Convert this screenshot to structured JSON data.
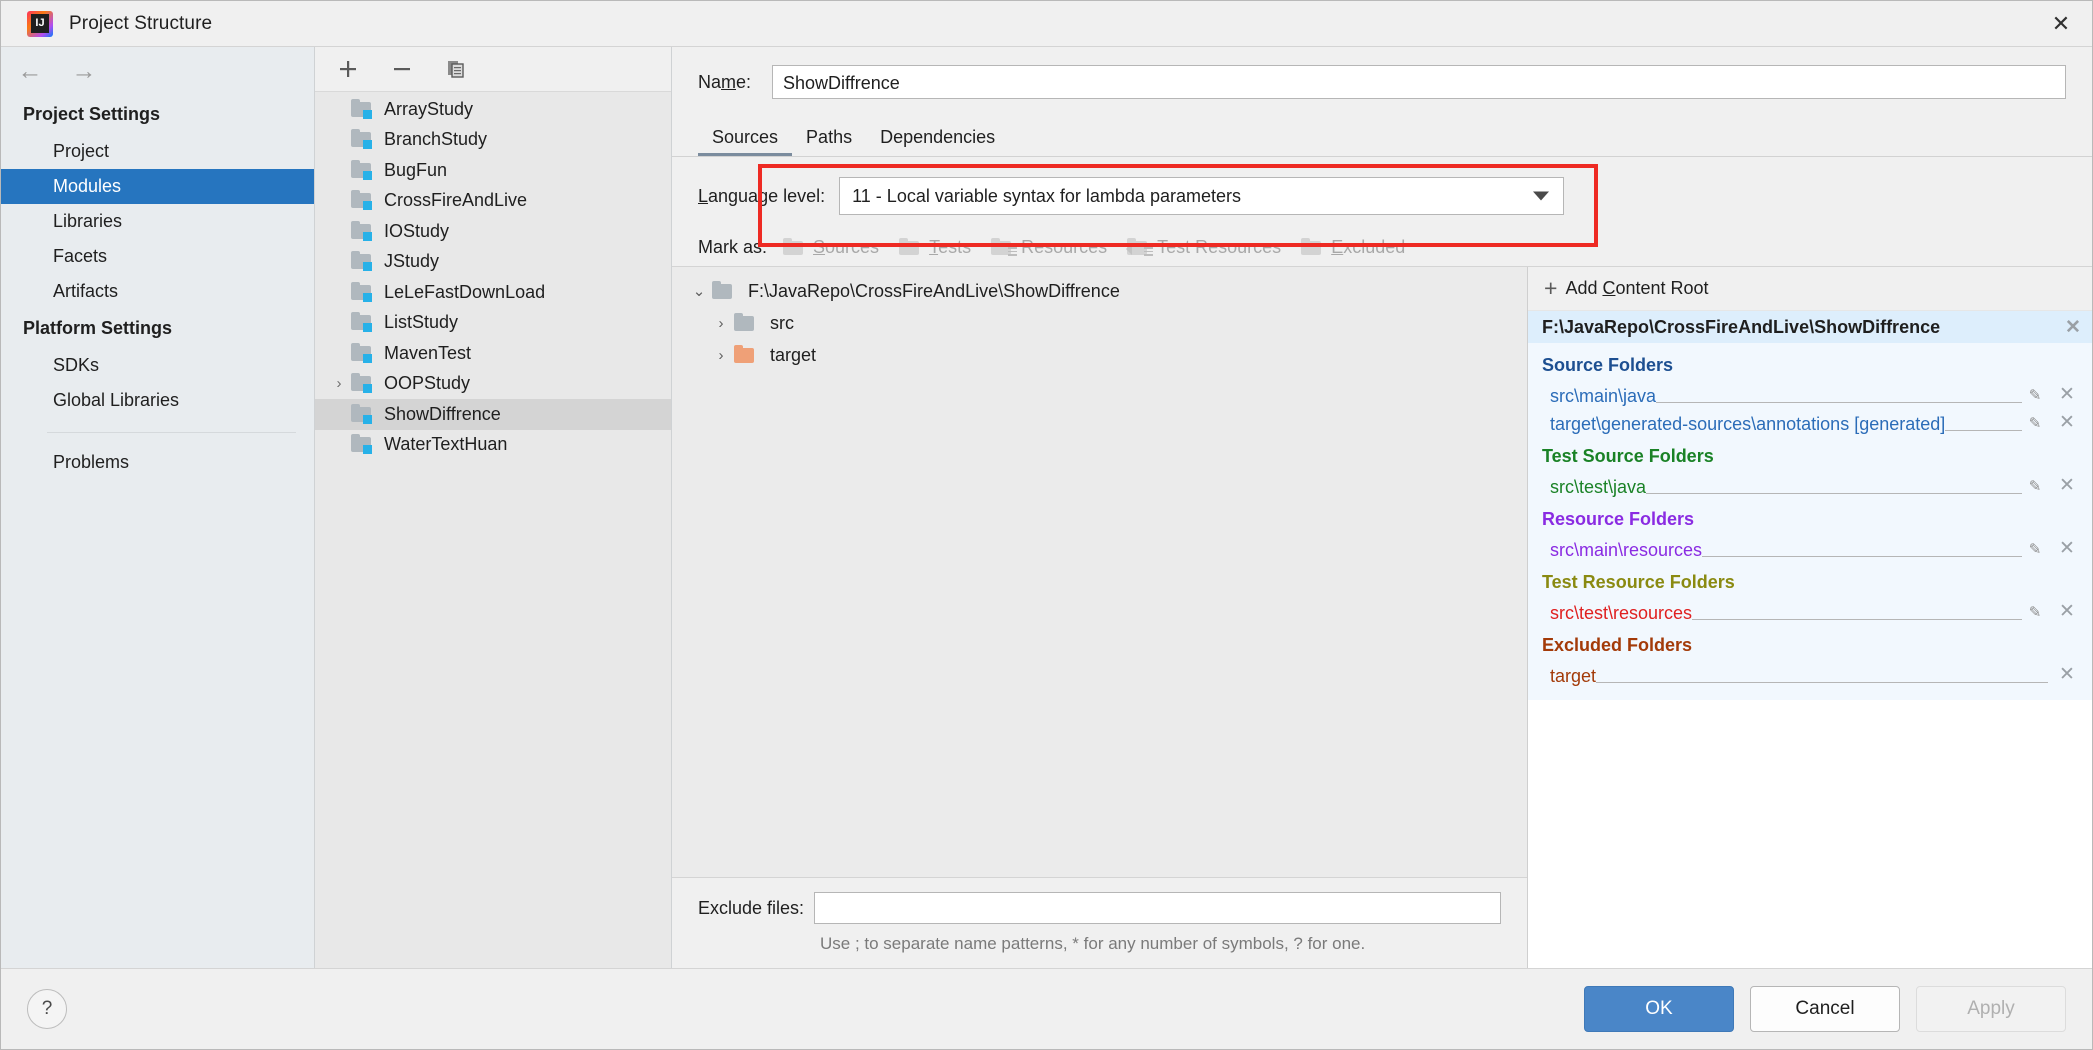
{
  "window": {
    "title": "Project Structure",
    "logo_icon": "intellij-idea-logo",
    "close_icon": "close-icon"
  },
  "sidebar": {
    "back_icon": "arrow-left-icon",
    "forward_icon": "arrow-right-icon",
    "groups": [
      {
        "label": "Project Settings",
        "items": [
          {
            "label": "Project",
            "selected": false
          },
          {
            "label": "Modules",
            "selected": true
          },
          {
            "label": "Libraries",
            "selected": false
          },
          {
            "label": "Facets",
            "selected": false
          },
          {
            "label": "Artifacts",
            "selected": false
          }
        ]
      },
      {
        "label": "Platform Settings",
        "items": [
          {
            "label": "SDKs",
            "selected": false
          },
          {
            "label": "Global Libraries",
            "selected": false
          }
        ]
      }
    ],
    "problems_label": "Problems",
    "selected_color": "#2675bf"
  },
  "module_list": {
    "toolbar": {
      "add_icon": "plus-icon",
      "remove_icon": "minus-icon",
      "copy_icon": "copy-icon"
    },
    "modules": [
      {
        "label": "ArrayStudy",
        "expandable": false,
        "selected": false
      },
      {
        "label": "BranchStudy",
        "expandable": false,
        "selected": false
      },
      {
        "label": "BugFun",
        "expandable": false,
        "selected": false
      },
      {
        "label": "CrossFireAndLive",
        "expandable": false,
        "selected": false
      },
      {
        "label": "IOStudy",
        "expandable": false,
        "selected": false
      },
      {
        "label": "JStudy",
        "expandable": false,
        "selected": false
      },
      {
        "label": "LeLeFastDownLoad",
        "expandable": false,
        "selected": false
      },
      {
        "label": "ListStudy",
        "expandable": false,
        "selected": false
      },
      {
        "label": "MavenTest",
        "expandable": false,
        "selected": false
      },
      {
        "label": "OOPStudy",
        "expandable": true,
        "selected": false
      },
      {
        "label": "ShowDiffrence",
        "expandable": false,
        "selected": true
      },
      {
        "label": "WaterTextHuan",
        "expandable": false,
        "selected": false
      }
    ]
  },
  "main": {
    "name_label": "Name:",
    "name_label_mnemonic": "m",
    "name_value": "ShowDiffrence",
    "tabs": [
      {
        "label": "Sources",
        "active": true
      },
      {
        "label": "Paths",
        "active": false
      },
      {
        "label": "Dependencies",
        "active": false
      }
    ],
    "language_level": {
      "label": "Language level:",
      "label_mnemonic": "L",
      "value": "11 - Local variable syntax for lambda parameters",
      "dropdown_icon": "chevron-down-icon",
      "highlight_color": "#ee2a23"
    },
    "mark_as": {
      "label": "Mark as:",
      "buttons": [
        {
          "label": "Sources",
          "mnemonic": "S",
          "icon": "folder-icon"
        },
        {
          "label": "Tests",
          "mnemonic": "T",
          "icon": "folder-icon"
        },
        {
          "label": "Resources",
          "mnemonic": "R",
          "icon": "folder-lines-icon"
        },
        {
          "label": "Test Resources",
          "mnemonic": "",
          "icon": "folder-test-resources-icon"
        },
        {
          "label": "Excluded",
          "mnemonic": "E",
          "icon": "folder-icon"
        }
      ]
    },
    "tree": [
      {
        "label": "F:\\JavaRepo\\CrossFireAndLive\\ShowDiffrence",
        "depth": 0,
        "twisty": "expanded",
        "icon": "folder-icon",
        "color": "gray"
      },
      {
        "label": "src",
        "depth": 1,
        "twisty": "collapsed",
        "icon": "folder-icon",
        "color": "gray"
      },
      {
        "label": "target",
        "depth": 1,
        "twisty": "collapsed",
        "icon": "folder-icon",
        "color": "orange"
      }
    ],
    "exclude": {
      "label": "Exclude files:",
      "value": "",
      "hint": "Use ; to separate name patterns, * for any number of symbols, ? for one."
    }
  },
  "content_roots": {
    "add_label": "Add Content Root",
    "add_mnemonic": "C",
    "add_icon": "plus-icon",
    "root_path": "F:\\JavaRepo\\CrossFireAndLive\\ShowDiffrence",
    "root_remove_icon": "close-icon",
    "groups": [
      {
        "title": "Source Folders",
        "kind": "src",
        "color": "#1d4f91",
        "paths": [
          {
            "text": "src\\main\\java",
            "has_edit": true,
            "has_remove": true
          },
          {
            "text": "target\\generated-sources\\annotations [generated]",
            "has_edit": true,
            "has_remove": true
          }
        ]
      },
      {
        "title": "Test Source Folders",
        "kind": "tsrc",
        "color": "#1a8226",
        "paths": [
          {
            "text": "src\\test\\java",
            "has_edit": true,
            "has_remove": true
          }
        ]
      },
      {
        "title": "Resource Folders",
        "kind": "res",
        "color": "#8a2be2",
        "paths": [
          {
            "text": "src\\main\\resources",
            "has_edit": true,
            "has_remove": true
          }
        ]
      },
      {
        "title": "Test Resource Folders",
        "kind": "tres",
        "color": "#8a8a11",
        "paths": [
          {
            "text": "src\\test\\resources",
            "has_edit": true,
            "has_remove": true
          }
        ]
      },
      {
        "title": "Excluded Folders",
        "kind": "exc",
        "color": "#a33a08",
        "paths": [
          {
            "text": "target",
            "has_edit": false,
            "has_remove": true
          }
        ]
      }
    ],
    "edit_icon": "pencil-icon",
    "remove_icon": "close-icon"
  },
  "footer": {
    "help_label": "?",
    "help_icon": "help-icon",
    "ok_label": "OK",
    "cancel_label": "Cancel",
    "apply_label": "Apply",
    "apply_disabled": true,
    "primary_color": "#4a86c8"
  }
}
